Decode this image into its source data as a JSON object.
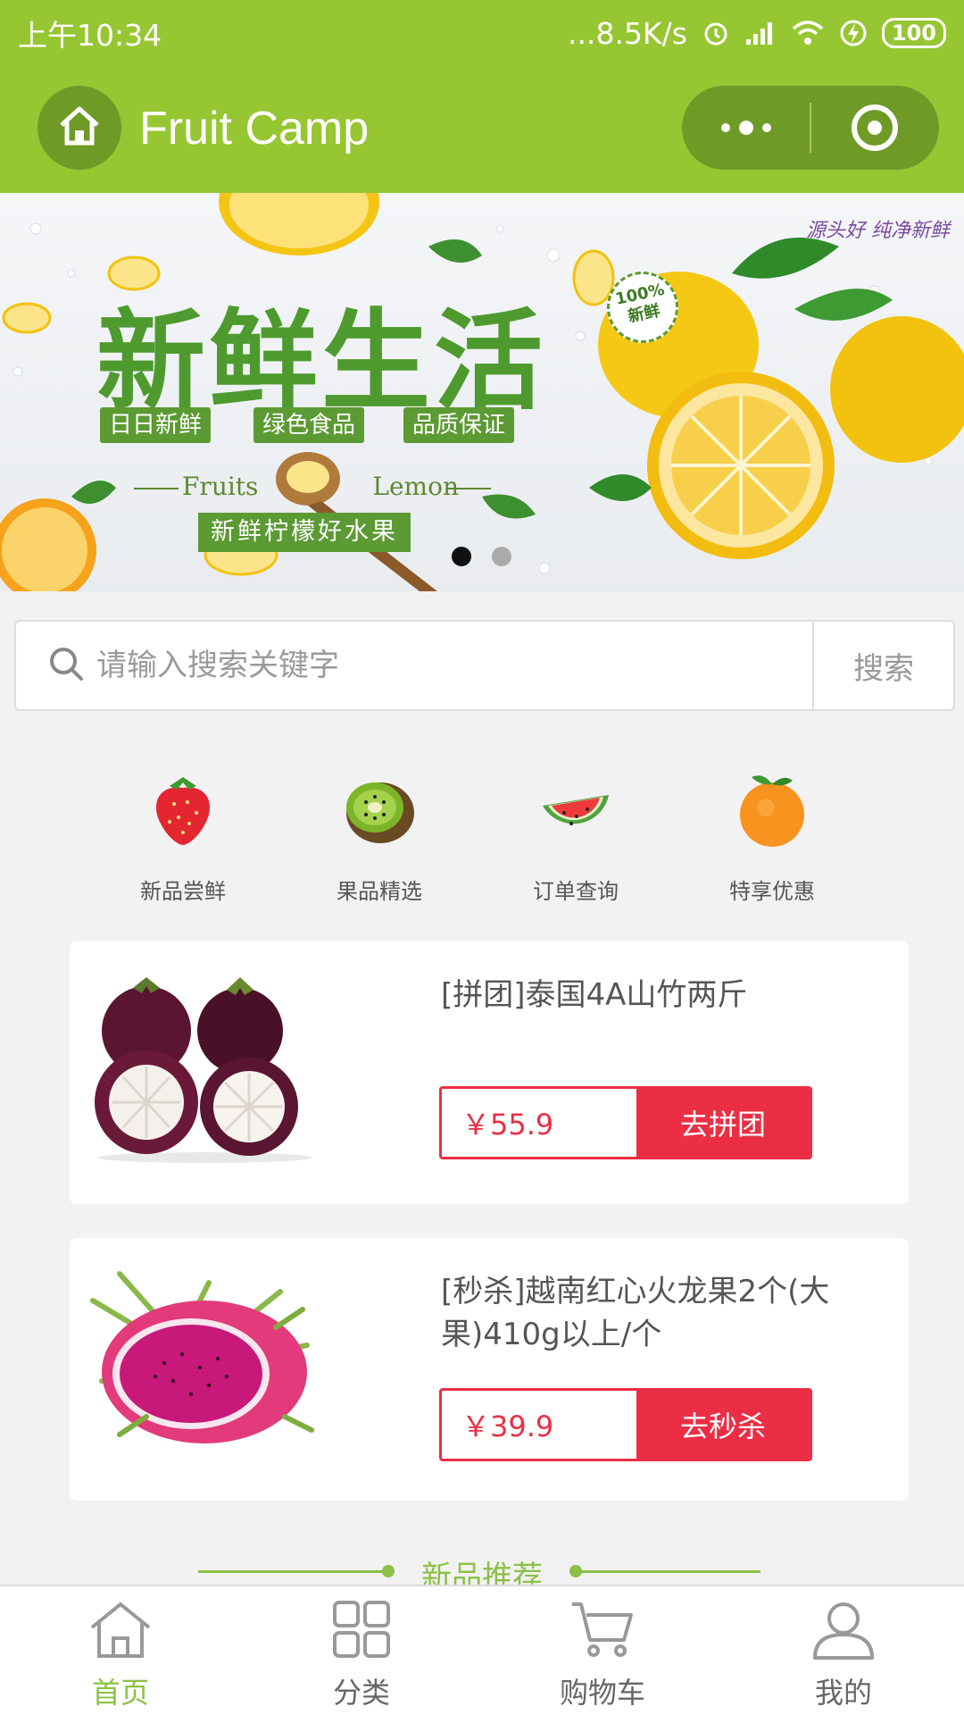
{
  "status_bar": {
    "time": "上午10:34",
    "network_speed": "...8.5K/s",
    "battery": "100"
  },
  "navbar": {
    "title": "Fruit Camp"
  },
  "banner": {
    "title": "新鲜生活",
    "tags": [
      "日日新鲜",
      "绿色食品",
      "品质保证"
    ],
    "fruits_word": "Fruits",
    "lemon_word": "Lemon",
    "subtitle": "新鲜柠檬好水果",
    "badge_line1": "100%",
    "badge_line2": "新鲜",
    "signature": "源头好 纯净新鲜",
    "page_count": 2,
    "active_page": 1
  },
  "search": {
    "placeholder": "请输入搜索关键字",
    "button_label": "搜索"
  },
  "categories": [
    {
      "label": "新品尝鲜",
      "icon": "strawberry-icon"
    },
    {
      "label": "果品精选",
      "icon": "kiwi-icon"
    },
    {
      "label": "订单查询",
      "icon": "watermelon-icon"
    },
    {
      "label": "特享优惠",
      "icon": "orange-icon"
    }
  ],
  "products": [
    {
      "title": "[拼团]泰国4A山竹两斤",
      "price": "￥55.9",
      "action": "去拼团",
      "image": "mangosteen"
    },
    {
      "title": "[秒杀]越南红心火龙果2个(大果)410g以上/个",
      "price": "￥39.9",
      "action": "去秒杀",
      "image": "dragon-fruit"
    }
  ],
  "section_heading": "新品推荐",
  "tabbar": {
    "items": [
      {
        "label": "首页",
        "icon": "home-icon",
        "active": true
      },
      {
        "label": "分类",
        "icon": "grid-icon",
        "active": false
      },
      {
        "label": "购物车",
        "icon": "cart-icon",
        "active": false
      },
      {
        "label": "我的",
        "icon": "user-icon",
        "active": false
      }
    ]
  },
  "colors": {
    "brand_green": "#97c633",
    "accent_red": "#ec2e44",
    "tab_active": "#8cc046"
  }
}
